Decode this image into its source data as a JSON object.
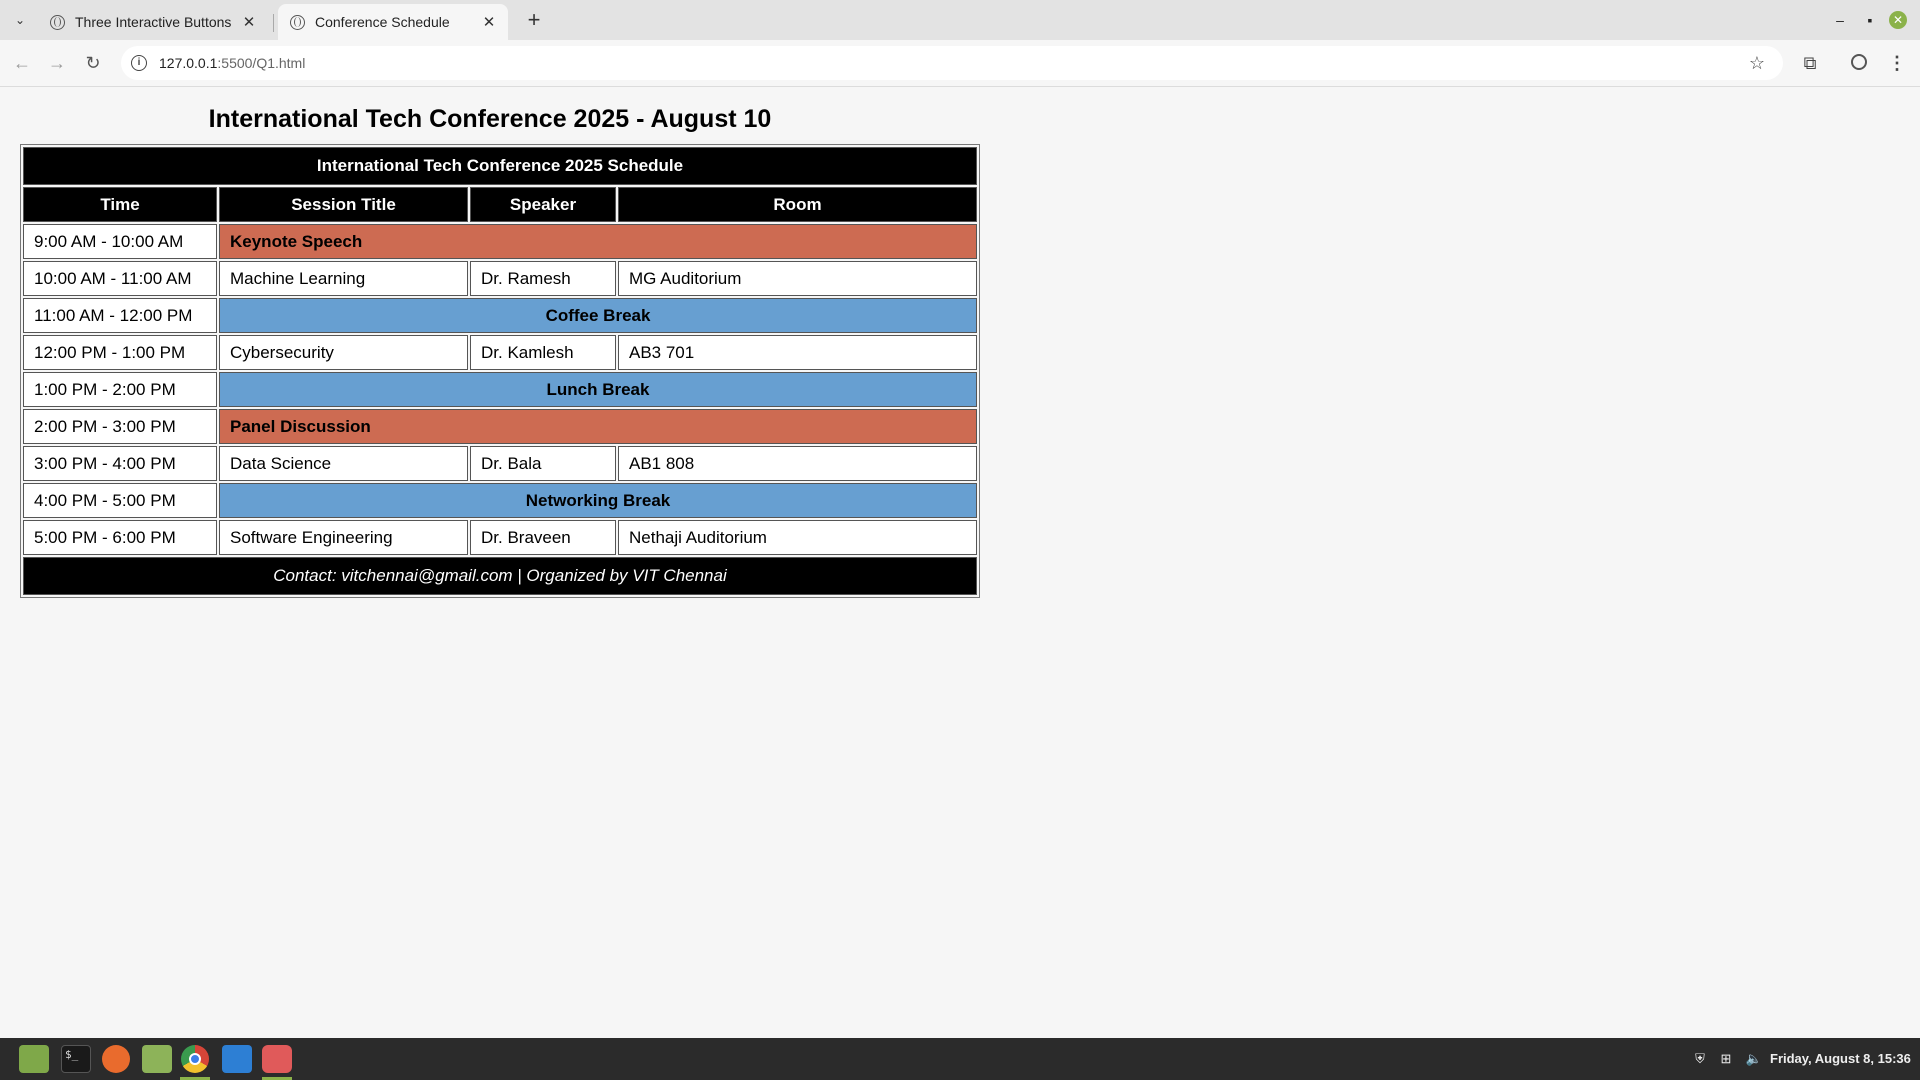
{
  "browser": {
    "tabs": [
      {
        "title": "Three Interactive Buttons",
        "active": false
      },
      {
        "title": "Conference Schedule",
        "active": true
      }
    ],
    "address": {
      "host": "127.0.0.1",
      "rest": ":5500/Q1.html"
    }
  },
  "page": {
    "heading": "International Tech Conference 2025 - August 10",
    "table": {
      "caption": "International Tech Conference 2025 Schedule",
      "headers": [
        "Time",
        "Session Title",
        "Speaker",
        "Room"
      ],
      "rows": [
        {
          "time": "9:00 AM - 10:00 AM",
          "merged": "Keynote Speech",
          "style": "orange"
        },
        {
          "time": "10:00 AM - 11:00 AM",
          "session": "Machine Learning",
          "speaker": "Dr. Ramesh",
          "room": "MG Auditorium"
        },
        {
          "time": "11:00 AM - 12:00 PM",
          "merged": "Coffee Break",
          "style": "blue"
        },
        {
          "time": "12:00 PM - 1:00 PM",
          "session": "Cybersecurity",
          "speaker": "Dr. Kamlesh",
          "room": "AB3 701"
        },
        {
          "time": "1:00 PM - 2:00 PM",
          "merged": "Lunch Break",
          "style": "blue"
        },
        {
          "time": "2:00 PM - 3:00 PM",
          "merged": "Panel Discussion",
          "style": "orange"
        },
        {
          "time": "3:00 PM - 4:00 PM",
          "session": "Data Science",
          "speaker": "Dr. Bala",
          "room": "AB1 808"
        },
        {
          "time": "4:00 PM - 5:00 PM",
          "merged": "Networking Break",
          "style": "blue"
        },
        {
          "time": "5:00 PM - 6:00 PM",
          "session": "Software Engineering",
          "speaker": "Dr. Braveen",
          "room": "Nethaji Auditorium"
        }
      ],
      "footer": "Contact: vitchennai@gmail.com | Organized by VIT Chennai"
    }
  },
  "taskbar": {
    "clock": "Friday, August  8, 15:36"
  },
  "colors": {
    "highlight_orange": "#cd6b52",
    "highlight_blue": "#679fd1",
    "header_black": "#000000"
  }
}
